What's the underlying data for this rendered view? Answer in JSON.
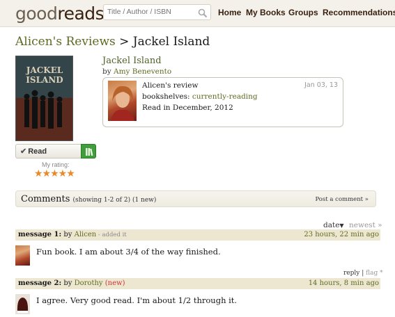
{
  "header": {
    "logo_light": "good",
    "logo_bold": "reads",
    "search": {
      "placeholder": "Title / Author / ISBN",
      "value": ""
    },
    "nav": [
      "Home",
      "My Books",
      "Groups",
      "Recommendations"
    ]
  },
  "page_title": {
    "crumb": "Alicen's Reviews",
    "separator": " > ",
    "book": "Jackel Island"
  },
  "book": {
    "cover_title": "JACKEL ISLAND",
    "title": "Jackel Island",
    "by_label": "by",
    "author": "Amy Benevento",
    "read_button": "Read",
    "my_rating_label": "My rating:",
    "rating": 5,
    "rating_stars": "★★★★★"
  },
  "review": {
    "heading": "Alicen's review",
    "date": "Jan 03, 13",
    "shelves_label": "bookshelves:",
    "shelf": "currently-reading",
    "read_info": "Read in December, 2012"
  },
  "comments": {
    "title": "Comments",
    "meta": "(showing 1-2 of 2) (1 new)",
    "post_link": "Post a comment »",
    "sort_date": "date",
    "sort_newest": "newest »",
    "messages": [
      {
        "label": "message 1:",
        "by": "by",
        "author": "Alicen",
        "note": " - added it",
        "new_tag": "",
        "time": "23 hours, 22 min ago",
        "text": "Fun book. I am about 3/4 of the way finished."
      },
      {
        "label": "message 2:",
        "by": "by",
        "author": "Dorothy",
        "note": "",
        "new_tag": "(new)",
        "time": "14 hours, 8 min ago",
        "text": "I agree. Very good read. I'm about 1/2 through it."
      }
    ],
    "reply_link": "reply",
    "separator": "|",
    "flag_link": "flag *"
  },
  "colors": {
    "header_bg": "#f4f1ea",
    "link_green": "#5d6b22",
    "message_bar": "#ede7d2",
    "star": "#e88a2b",
    "shelf_button": "#409d3c"
  }
}
